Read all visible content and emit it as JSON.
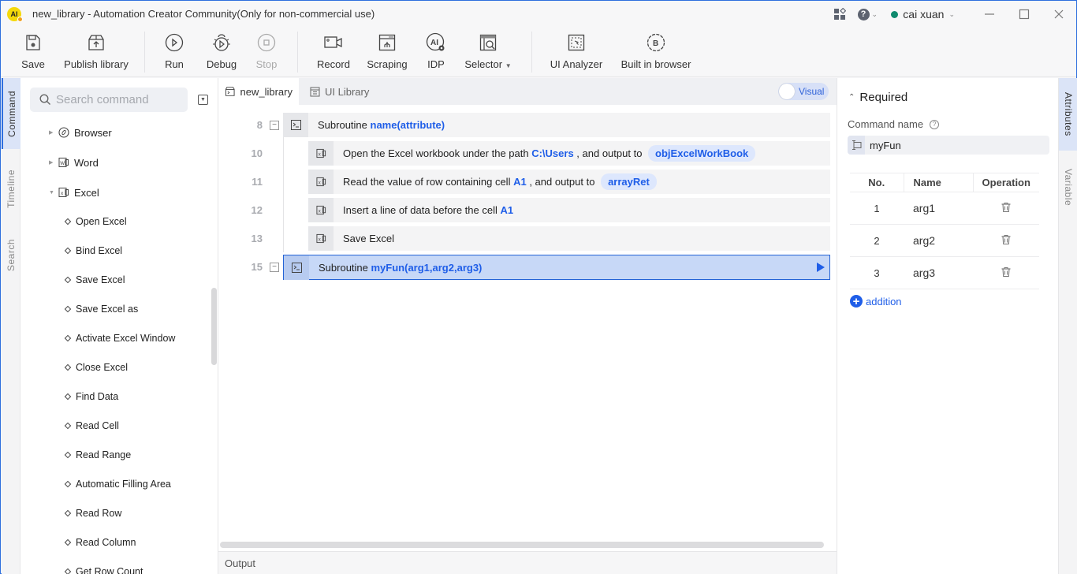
{
  "window": {
    "title": "new_library - Automation Creator Community(Only for non-commercial use)",
    "logo_text": "AI",
    "user_name": "cai xuan"
  },
  "toolbar": {
    "save": "Save",
    "publish_library": "Publish library",
    "run": "Run",
    "debug": "Debug",
    "stop": "Stop",
    "record": "Record",
    "scraping": "Scraping",
    "idp": "IDP",
    "selector": "Selector",
    "ui_analyzer": "UI Analyzer",
    "built_in_browser": "Built in browser"
  },
  "left_tabs": [
    "Command",
    "Timeline",
    "Search"
  ],
  "command_panel": {
    "search_placeholder": "Search command",
    "categories": [
      {
        "label": "Browser",
        "expanded": false
      },
      {
        "label": "Word",
        "expanded": false
      },
      {
        "label": "Excel",
        "expanded": true
      }
    ],
    "excel_items": [
      "Open Excel",
      "Bind Excel",
      "Save Excel",
      "Save Excel as",
      "Activate Excel Window",
      "Close Excel",
      "Find Data",
      "Read Cell",
      "Read Range",
      "Automatic Filling Area",
      "Read Row",
      "Read Column",
      "Get Row Count"
    ]
  },
  "editor": {
    "tabs": [
      {
        "label": "new_library",
        "active": true
      },
      {
        "label": "UI Library",
        "active": false
      }
    ],
    "visual_toggle_label": "Visual",
    "lines": [
      {
        "num": "8",
        "prefix": "Subroutine ",
        "name": "name(attribute)"
      },
      {
        "num": "10",
        "text1": "Open the Excel workbook under the path ",
        "arg1": "C:\\Users",
        "text2": " , and output to ",
        "var": "objExcelWorkBook"
      },
      {
        "num": "11",
        "text1": "Read the value of row containing cell ",
        "arg1": "A1",
        "text2": " , and output to ",
        "var": "arrayRet"
      },
      {
        "num": "12",
        "text1": "Insert a line of data before the cell ",
        "arg1": "A1"
      },
      {
        "num": "13",
        "text1": "Save Excel"
      },
      {
        "num": "15",
        "prefix": "Subroutine ",
        "name": "myFun(arg1,arg2,arg3)"
      }
    ],
    "output_label": "Output"
  },
  "attributes": {
    "section_title": "Required",
    "command_name_label": "Command name",
    "command_name_value": "myFun",
    "table_headers": [
      "No.",
      "Name",
      "Operation"
    ],
    "params": [
      {
        "no": "1",
        "name": "arg1"
      },
      {
        "no": "2",
        "name": "arg2"
      },
      {
        "no": "3",
        "name": "arg3"
      }
    ],
    "add_label": "addition"
  },
  "right_tabs": [
    "Attributes",
    "Variable"
  ],
  "colors": {
    "accent": "#1f5ee8",
    "selected_row_bg": "#c7d8f7",
    "user_status": "#0f8a6e",
    "window_border": "#2f6fde"
  }
}
